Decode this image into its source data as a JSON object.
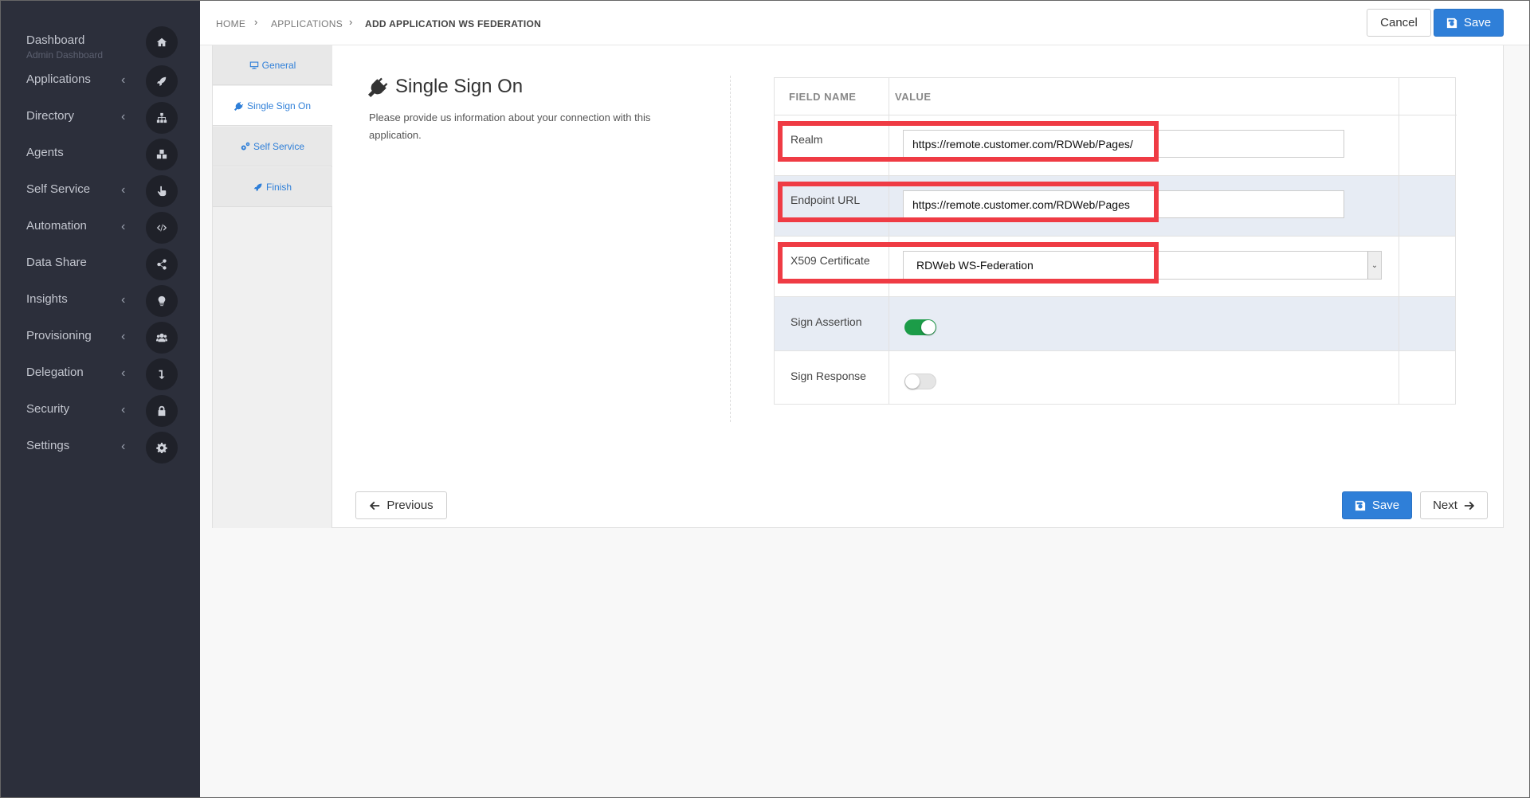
{
  "sidebar": {
    "items": [
      {
        "label": "Dashboard",
        "sub": "Admin Dashboard",
        "icon": "home-icon",
        "has_chevron": false
      },
      {
        "label": "Applications",
        "icon": "rocket-icon",
        "has_chevron": true
      },
      {
        "label": "Directory",
        "icon": "sitemap-icon",
        "has_chevron": true
      },
      {
        "label": "Agents",
        "icon": "cubes-icon",
        "has_chevron": false
      },
      {
        "label": "Self Service",
        "icon": "hand-pointer-icon",
        "has_chevron": true
      },
      {
        "label": "Automation",
        "icon": "code-icon",
        "has_chevron": true
      },
      {
        "label": "Data Share",
        "icon": "share-icon",
        "has_chevron": false
      },
      {
        "label": "Insights",
        "icon": "lightbulb-icon",
        "has_chevron": true
      },
      {
        "label": "Provisioning",
        "icon": "users-icon",
        "has_chevron": true
      },
      {
        "label": "Delegation",
        "icon": "level-down-icon",
        "has_chevron": true
      },
      {
        "label": "Security",
        "icon": "lock-icon",
        "has_chevron": true
      },
      {
        "label": "Settings",
        "icon": "gear-icon",
        "has_chevron": true
      }
    ],
    "chevron": "‹"
  },
  "breadcrumb": {
    "items": [
      "HOME",
      "APPLICATIONS",
      "ADD APPLICATION WS FEDERATION"
    ],
    "separator": "›"
  },
  "toolbar": {
    "cancel_label": "Cancel",
    "save_label": "Save"
  },
  "steps": [
    {
      "label": "General",
      "icon": "desktop-icon"
    },
    {
      "label": "Single Sign On",
      "icon": "plug-icon",
      "active": true
    },
    {
      "label": "Self Service",
      "icon": "cogs-icon"
    },
    {
      "label": "Finish",
      "icon": "rocket-icon"
    }
  ],
  "section": {
    "title": "Single Sign On",
    "description": "Please provide us information about your connection with this application."
  },
  "fields": {
    "header_name": "FIELD NAME",
    "header_value": "VALUE",
    "realm_label": "Realm",
    "realm_value": "https://remote.customer.com/RDWeb/Pages/",
    "endpoint_label": "Endpoint URL",
    "endpoint_value": "https://remote.customer.com/RDWeb/Pages",
    "cert_label": "X509 Certificate",
    "cert_value": "RDWeb WS-Federation",
    "sign_assertion_label": "Sign Assertion",
    "sign_assertion_on": true,
    "sign_response_label": "Sign Response",
    "sign_response_on": false
  },
  "footer": {
    "previous_label": "Previous",
    "save_label": "Save",
    "next_label": "Next"
  },
  "colors": {
    "sidebar_bg": "#2c2f3b",
    "primary": "#2f7fd8",
    "highlight": "#ef3b44",
    "toggle_on": "#1c9c48"
  }
}
